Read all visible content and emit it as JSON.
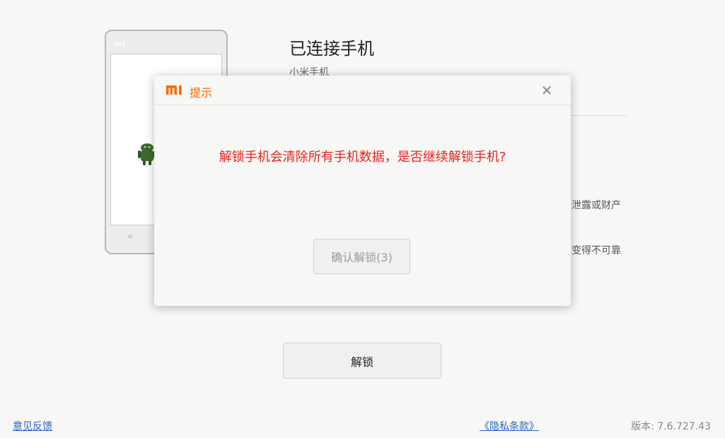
{
  "main": {
    "title": "已连接手机",
    "subtitle": "小米手机",
    "bg_line1": "泄露或财产",
    "bg_line2": "变得不可靠",
    "unlock_button": "解锁"
  },
  "phone": {
    "logo": "mi",
    "menu_glyph": "≡"
  },
  "footer": {
    "feedback": "意见反馈",
    "privacy": "《隐私条款》",
    "version": "版本: 7.6.727.43"
  },
  "dialog": {
    "title": "提示",
    "close_glyph": "✕",
    "message": "解锁手机会清除所有手机数据，是否继续解锁手机?",
    "confirm_button": "确认解锁(3)"
  },
  "colors": {
    "brand_orange": "#ff6700",
    "warning_red": "#e8231b",
    "link_blue": "#2c64c8",
    "android_green": "#3d6b2c"
  },
  "icons": {
    "brand": "mi-logo-icon",
    "close": "close-icon",
    "android": "android-icon"
  }
}
